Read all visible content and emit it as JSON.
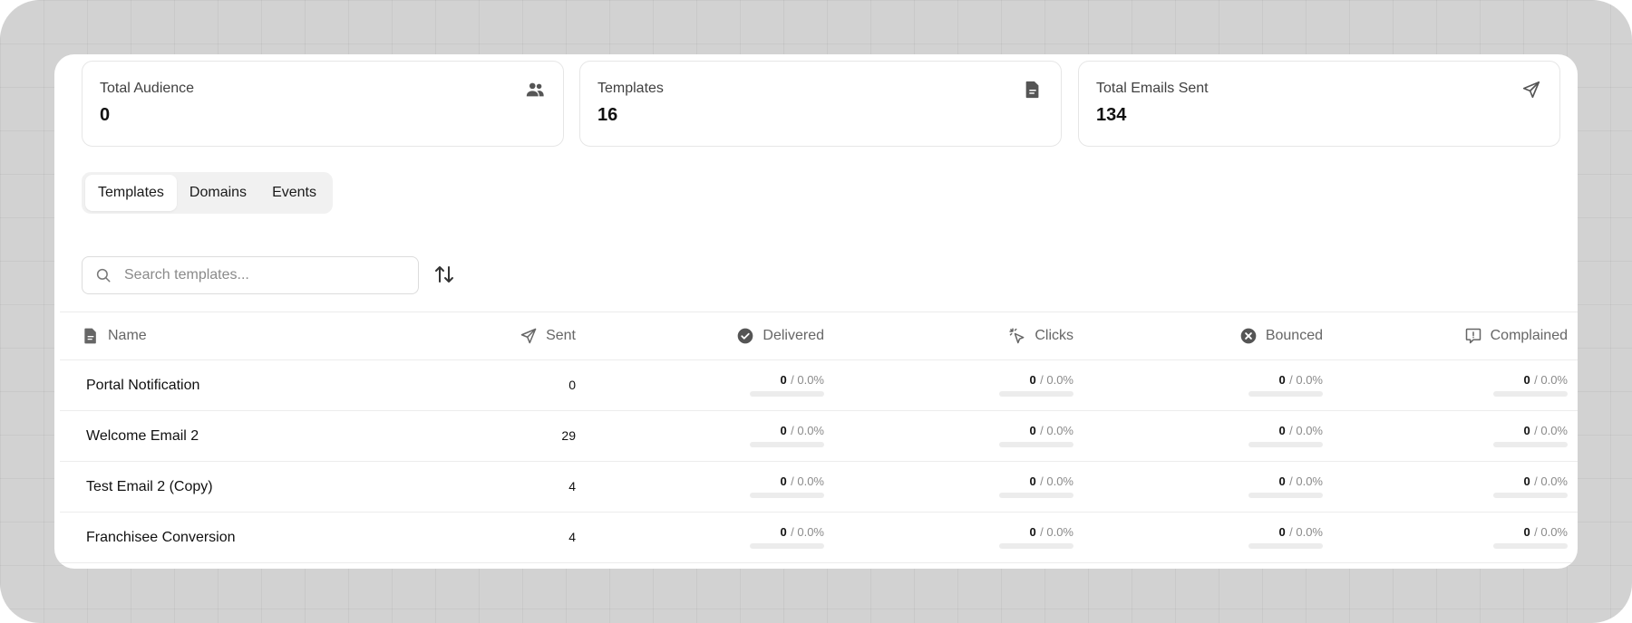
{
  "stats": [
    {
      "label": "Total Audience",
      "value": "0",
      "icon": "users-icon"
    },
    {
      "label": "Templates",
      "value": "16",
      "icon": "document-icon"
    },
    {
      "label": "Total Emails Sent",
      "value": "134",
      "icon": "send-icon"
    }
  ],
  "tabs": [
    {
      "label": "Templates",
      "active": true
    },
    {
      "label": "Domains",
      "active": false
    },
    {
      "label": "Events",
      "active": false
    }
  ],
  "search": {
    "placeholder": "Search templates...",
    "value": ""
  },
  "table": {
    "headers": {
      "name": "Name",
      "sent": "Sent",
      "delivered": "Delivered",
      "clicks": "Clicks",
      "bounced": "Bounced",
      "complained": "Complained"
    },
    "rows": [
      {
        "name": "Portal Notification",
        "sent": "0",
        "delivered": {
          "count": "0",
          "pct": "/ 0.0%",
          "fraction": 0
        },
        "clicks": {
          "count": "0",
          "pct": "/ 0.0%",
          "fraction": 0
        },
        "bounced": {
          "count": "0",
          "pct": "/ 0.0%",
          "fraction": 0
        },
        "complained": {
          "count": "0",
          "pct": "/ 0.0%",
          "fraction": 0
        }
      },
      {
        "name": "Welcome Email 2",
        "sent": "29",
        "delivered": {
          "count": "0",
          "pct": "/ 0.0%",
          "fraction": 0
        },
        "clicks": {
          "count": "0",
          "pct": "/ 0.0%",
          "fraction": 0
        },
        "bounced": {
          "count": "0",
          "pct": "/ 0.0%",
          "fraction": 0
        },
        "complained": {
          "count": "0",
          "pct": "/ 0.0%",
          "fraction": 0
        }
      },
      {
        "name": "Test Email 2 (Copy)",
        "sent": "4",
        "delivered": {
          "count": "0",
          "pct": "/ 0.0%",
          "fraction": 0
        },
        "clicks": {
          "count": "0",
          "pct": "/ 0.0%",
          "fraction": 0
        },
        "bounced": {
          "count": "0",
          "pct": "/ 0.0%",
          "fraction": 0
        },
        "complained": {
          "count": "0",
          "pct": "/ 0.0%",
          "fraction": 0
        }
      },
      {
        "name": "Franchisee Conversion",
        "sent": "4",
        "delivered": {
          "count": "0",
          "pct": "/ 0.0%",
          "fraction": 0
        },
        "clicks": {
          "count": "0",
          "pct": "/ 0.0%",
          "fraction": 0
        },
        "bounced": {
          "count": "0",
          "pct": "/ 0.0%",
          "fraction": 0
        },
        "complained": {
          "count": "0",
          "pct": "/ 0.0%",
          "fraction": 0
        }
      }
    ]
  }
}
